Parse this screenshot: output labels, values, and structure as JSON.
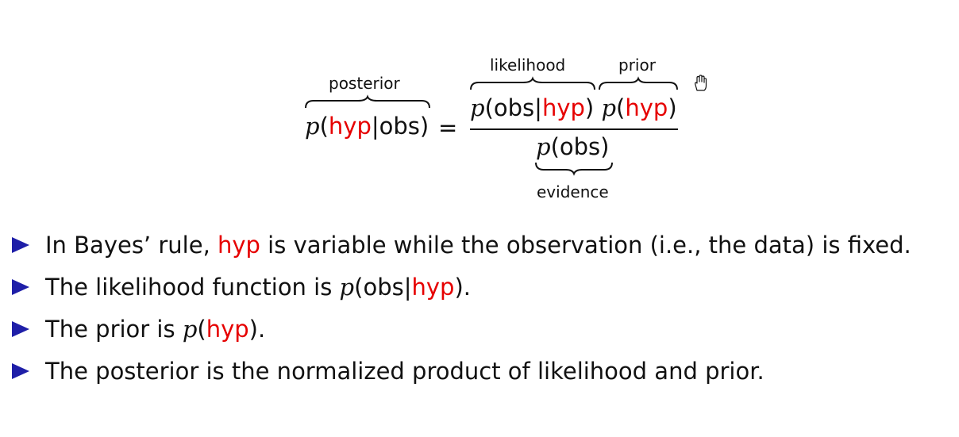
{
  "formula": {
    "labels": {
      "posterior": "posterior",
      "likelihood": "likelihood",
      "prior": "prior",
      "evidence": "evidence"
    },
    "p": "p",
    "hyp": "hyp",
    "obs": "obs",
    "paren_open": "(",
    "paren_close": ")",
    "given": "|",
    "equals": "="
  },
  "bullets": [
    {
      "before": "In Bayes’ rule, ",
      "highlight": "hyp",
      "after": " is variable while the observation (i.e., the data) is fixed."
    },
    {
      "before": "The likelihood function is ",
      "math_p": "p",
      "math_open": "(",
      "math_obs": "obs",
      "math_bar": "|",
      "math_hyp": "hyp",
      "math_close": ").",
      "highlight": "hyp"
    },
    {
      "before": "The prior is ",
      "math_p": "p",
      "math_open": "(",
      "math_hyp": "hyp",
      "math_close": ")."
    },
    {
      "before": "The posterior is the normalized product of likelihood and prior."
    }
  ],
  "colors": {
    "highlight": "#e60000",
    "bullet_marker": "#1f1fa8",
    "text": "#111111"
  },
  "icons": {
    "cursor": "hand-cursor-icon"
  }
}
